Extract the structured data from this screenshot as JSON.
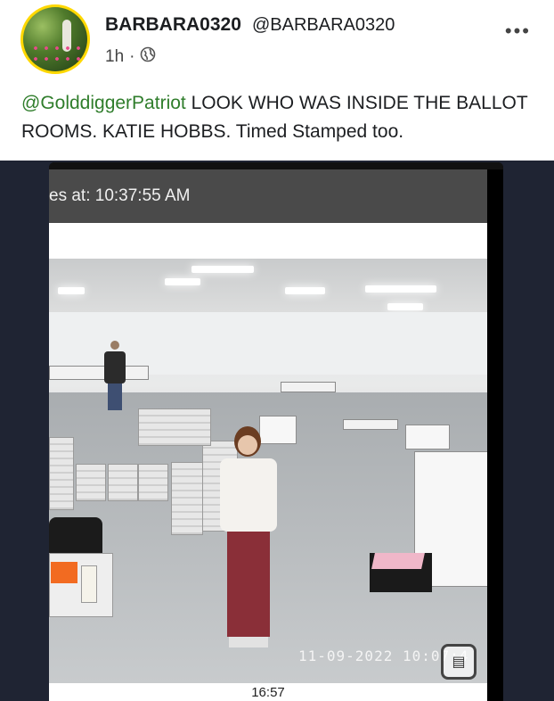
{
  "post": {
    "author_name": "BARBARA0320",
    "author_handle": "@BARBARA0320",
    "time": "1h",
    "separator": "·",
    "privacy_icon": "globe-icon",
    "more_icon": "more-options-icon",
    "mention": "@GolddiggerPatriot",
    "text": " LOOK WHO WAS INSIDE THE BALLOT ROOMS. KATIE HOBBS. Timed Stamped too."
  },
  "media": {
    "header_timestamp": "es at: 10:37:55 AM",
    "cctv_datetime": "11-09-2022 10:07:4",
    "video_time": "16:57",
    "scan_icon": "scan-text-icon"
  },
  "colors": {
    "mention": "#2f7d2b",
    "avatar_ring": "#ffd800",
    "media_background": "#1f2433"
  }
}
